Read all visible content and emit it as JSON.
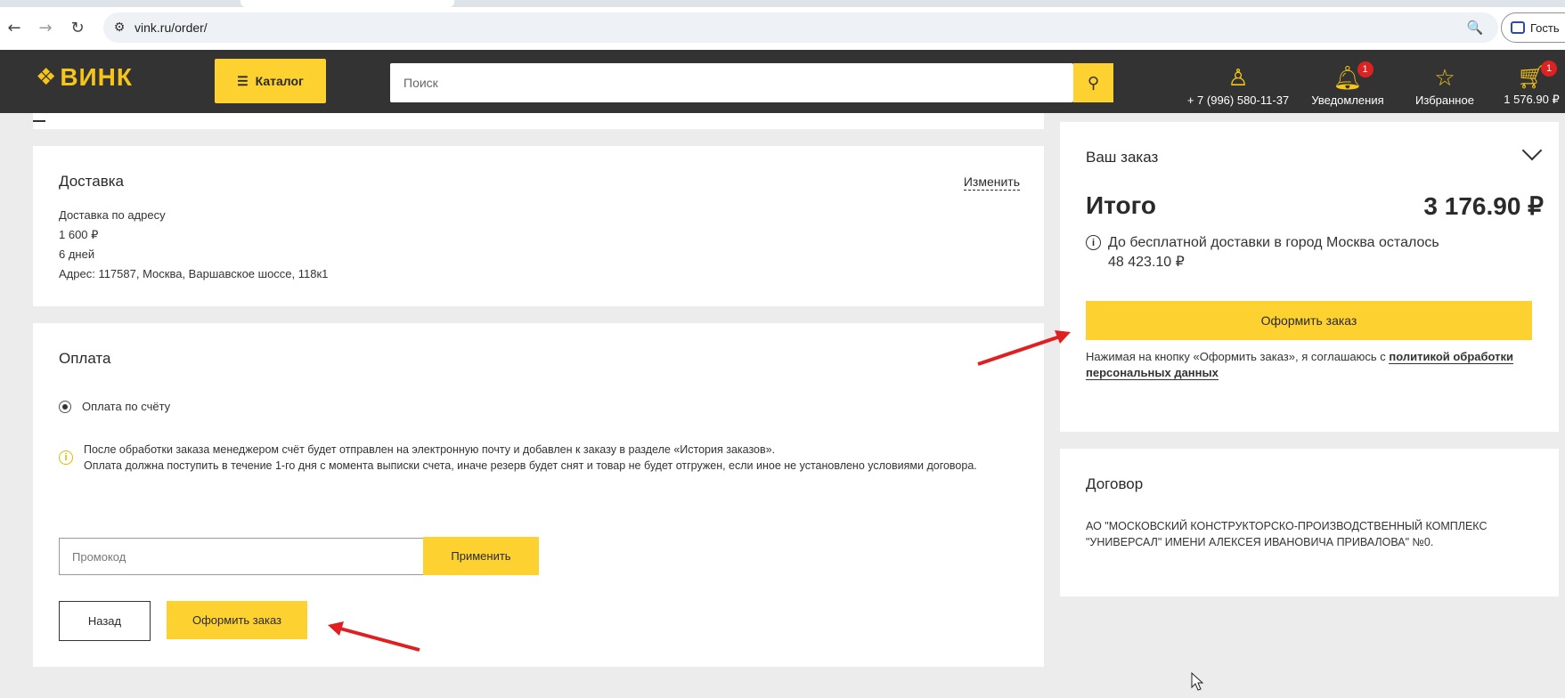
{
  "browser": {
    "url": "vink.ru/order/",
    "profile_label": "Гость"
  },
  "header": {
    "logo_text": "ВИНК",
    "catalog_label": "Каталог",
    "search_placeholder": "Поиск",
    "phone": "+ 7 (996) 580-11-37",
    "notifications_label": "Уведомления",
    "notifications_count": "1",
    "favorites_label": "Избранное",
    "cart_total": "1 576.90 ₽",
    "cart_count": "1"
  },
  "delivery": {
    "title": "Доставка",
    "change_label": "Изменить",
    "method": "Доставка по адресу",
    "price": "1 600 ₽",
    "duration": "6 дней",
    "address": "Адрес: 117587, Москва, Варшавское шоссе, 118к1"
  },
  "payment": {
    "title": "Оплата",
    "option_label": "Оплата по счёту",
    "note_line1": "После обработки заказа менеджером счёт будет отправлен на электронную почту и добавлен к заказу в разделе «История заказов».",
    "note_line2": "Оплата должна поступить в течение 1-го дня с момента выписки счета, иначе резерв будет снят и товар не будет отгружен, если иное не установлено условиями договора.",
    "promo_placeholder": "Промокод",
    "apply_label": "Применить",
    "back_label": "Назад",
    "submit_label": "Оформить заказ"
  },
  "summary": {
    "title": "Ваш заказ",
    "total_label": "Итого",
    "total_value": "3 176.90 ₽",
    "free_delivery_line1": "До бесплатной доставки в город Москва осталось",
    "free_delivery_line2": "48 423.10 ₽",
    "submit_label": "Оформить заказ",
    "consent_text": "Нажимая на кнопку «Оформить заказ», я соглашаюсь с ",
    "consent_link_1": "политикой обработки",
    "consent_link_2": "персональных данных"
  },
  "contract": {
    "title": "Договор",
    "line1": "АО \"МОСКОВСКИЙ КОНСТРУКТОРСКО-ПРОИЗВОДСТВЕННЫЙ КОМПЛЕКС",
    "line2": "\"УНИВЕРСАЛ\" ИМЕНИ АЛЕКСЕЯ ИВАНОВИЧА ПРИВАЛОВА\" №0."
  },
  "colors": {
    "accent": "#fdd130",
    "header_bg": "#333333",
    "annotation_arrow": "#e02020"
  }
}
